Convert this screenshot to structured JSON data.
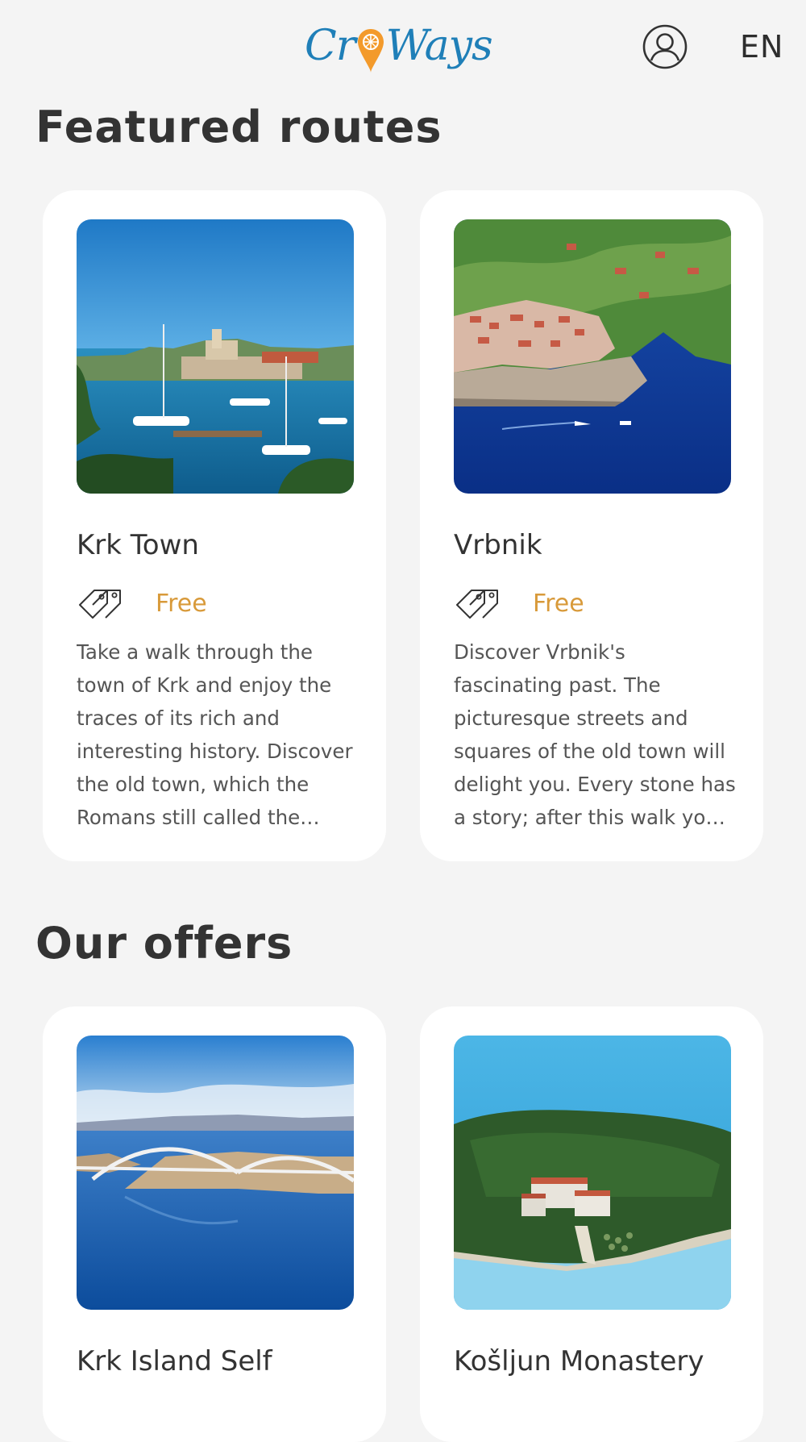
{
  "header": {
    "logo_text_left": "Cr",
    "logo_text_right": "Ways",
    "account_icon": "user-circle-icon",
    "language": "EN"
  },
  "featured": {
    "title": "Featured routes",
    "cards": [
      {
        "title": "Krk Town",
        "price": "Free",
        "price_icon": "price-tags-icon",
        "description": "Take a walk through the town of Krk and enjoy the traces of its rich and interesting history. Discover the old town, which the Romans still called the splendid city"
      },
      {
        "title": "Vrbnik",
        "price": "Free",
        "price_icon": "price-tags-icon",
        "description": "Discover Vrbnik's fascinating past. The picturesque streets and squares of the old town will delight you. Every stone has a story; after this walk you will know it"
      }
    ]
  },
  "offers": {
    "title": "Our offers",
    "cards": [
      {
        "title": "Krk Island Self"
      },
      {
        "title": "Košljun Monastery"
      }
    ]
  },
  "colors": {
    "background": "#f4f4f4",
    "card": "#ffffff",
    "brand_blue": "#1f7fb8",
    "brand_orange": "#f39a2b",
    "price": "#d89a3a",
    "heading": "#333333"
  }
}
